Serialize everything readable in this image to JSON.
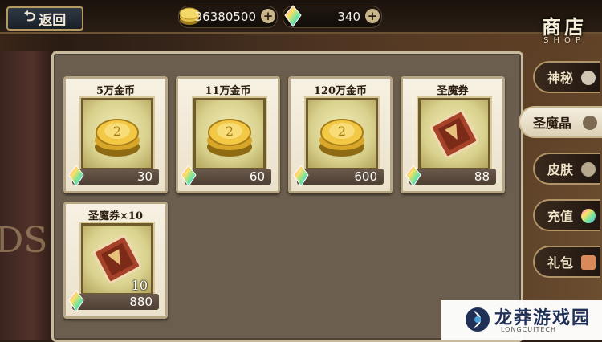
{
  "header": {
    "back_label": "返回",
    "coins": "36380500",
    "gems": "340",
    "shop_title": "商店",
    "shop_subtitle": "SHOP"
  },
  "items": [
    {
      "name": "5万金币",
      "price": "30",
      "icon": "coin-stack-icon"
    },
    {
      "name": "11万金币",
      "price": "60",
      "icon": "coin-stack-icon"
    },
    {
      "name": "120万金币",
      "price": "600",
      "icon": "coin-stack-icon"
    },
    {
      "name": "圣魔券",
      "price": "88",
      "icon": "ticket-icon"
    },
    {
      "name": "圣魔券×10",
      "price": "880",
      "icon": "ticket-icon",
      "quantity": "10"
    }
  ],
  "tabs": [
    {
      "label": "神秘",
      "active": false
    },
    {
      "label": "圣魔晶",
      "active": true
    },
    {
      "label": "皮肤",
      "active": false
    },
    {
      "label": "充值",
      "active": false
    },
    {
      "label": "礼包",
      "active": false
    }
  ],
  "watermark": {
    "cn": "龙莽游戏园",
    "en": "LONGCUITECH"
  },
  "colors": {
    "accent_gold": "#c9a44a",
    "panel": "#6b5e4e"
  }
}
